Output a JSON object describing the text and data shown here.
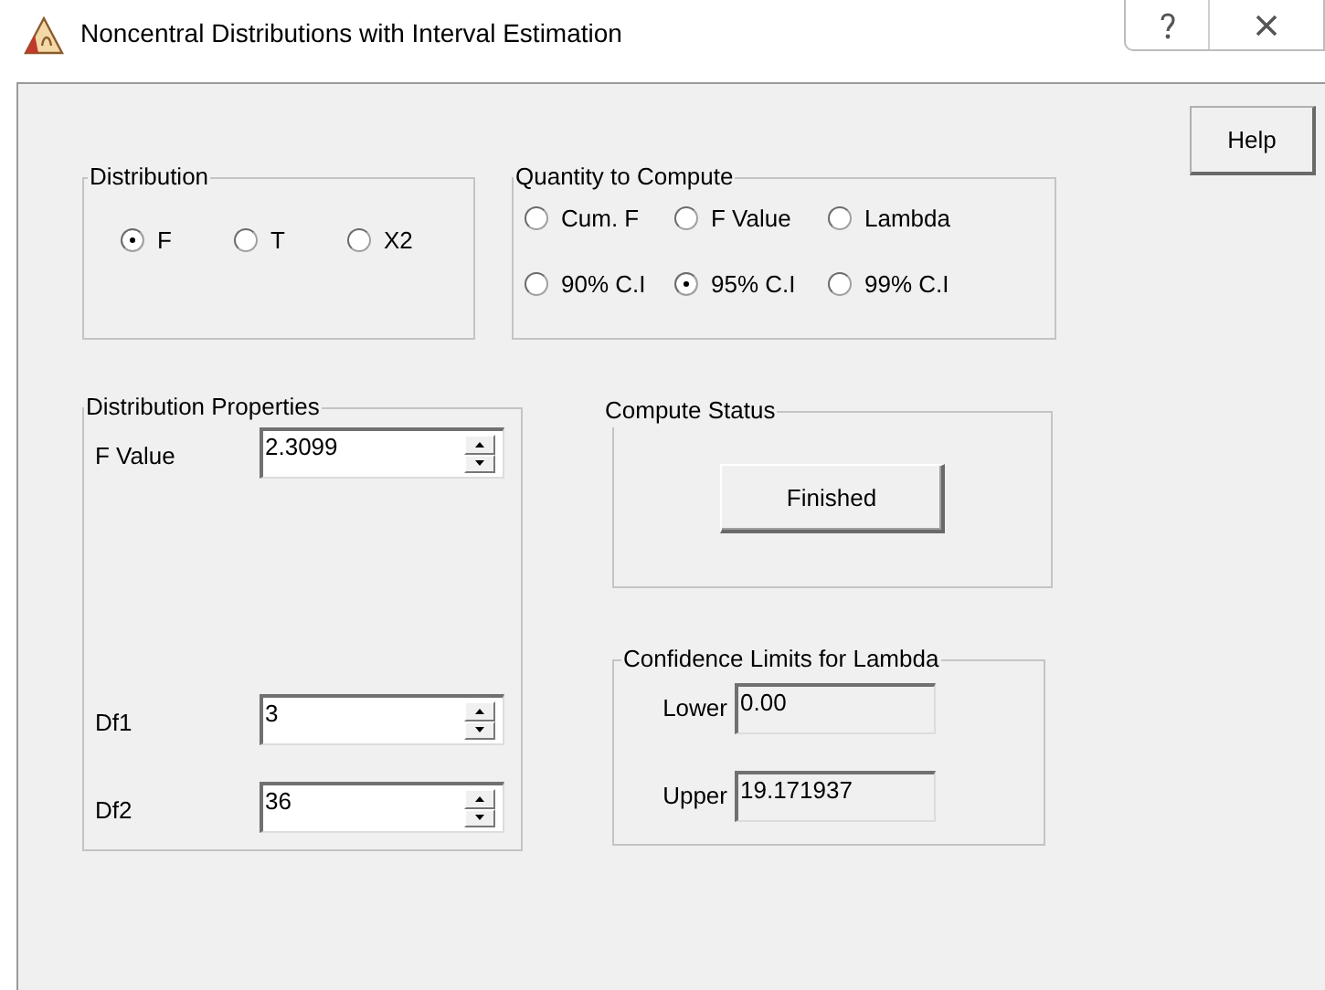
{
  "window": {
    "title": "Noncentral Distributions with Interval Estimation"
  },
  "distribution": {
    "title": "Distribution",
    "options": [
      {
        "label": "F",
        "selected": true
      },
      {
        "label": "T",
        "selected": false
      },
      {
        "label": "X2",
        "selected": false
      }
    ]
  },
  "quantity": {
    "title": "Quantity to Compute",
    "options": [
      {
        "label": "Cum. F",
        "selected": false
      },
      {
        "label": "F Value",
        "selected": false
      },
      {
        "label": "Lambda",
        "selected": false
      },
      {
        "label": "90% C.I",
        "selected": false
      },
      {
        "label": "95% C.I",
        "selected": true
      },
      {
        "label": "99% C.I",
        "selected": false
      }
    ]
  },
  "help_button": "Help",
  "properties": {
    "title": "Distribution Properties",
    "fields": [
      {
        "label": "F Value",
        "value": "2.3099"
      },
      {
        "label": "Df1",
        "value": "3"
      },
      {
        "label": "Df2",
        "value": "36"
      }
    ]
  },
  "compute_status": {
    "title": "Compute Status",
    "button": "Finished"
  },
  "confidence": {
    "title": "Confidence Limits for Lambda",
    "fields": [
      {
        "label": "Lower",
        "value": "0.00"
      },
      {
        "label": "Upper",
        "value": "19.171937"
      }
    ]
  }
}
